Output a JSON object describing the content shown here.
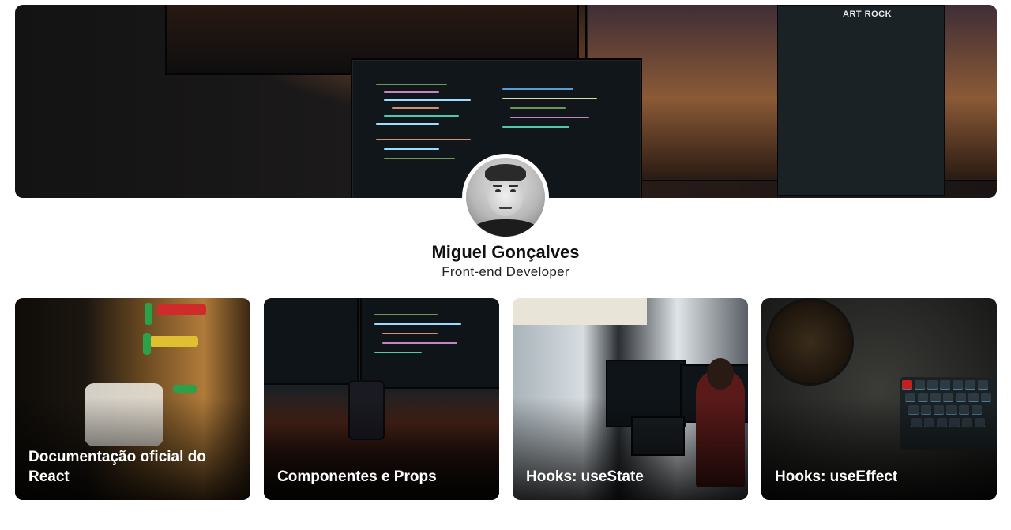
{
  "profile": {
    "name": "Miguel Gonçalves",
    "role": "Front-end Developer"
  },
  "cover": {
    "playlist_title": "ART ROCK"
  },
  "cards": [
    {
      "title": "Documentação oficial do React"
    },
    {
      "title": "Componentes e Props"
    },
    {
      "title": "Hooks: useState"
    },
    {
      "title": "Hooks: useEffect"
    }
  ],
  "colors": {
    "name_text": "#111111",
    "role_text": "#222222",
    "card_title_text": "#ffffff",
    "background": "#ffffff"
  }
}
